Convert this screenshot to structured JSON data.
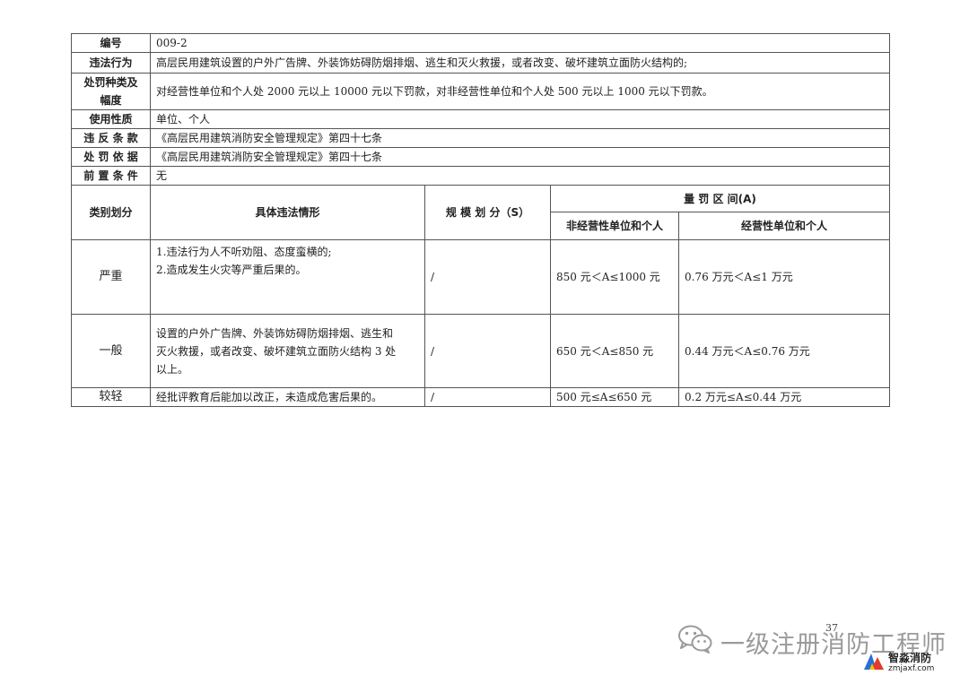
{
  "table": {
    "rows": {
      "code": {
        "label": "编号",
        "value": "009-2"
      },
      "violation": {
        "label": "违法行为",
        "value": "高层民用建筑设置的户外广告牌、外装饰妨碍防烟排烟、逃生和灭火救援，或者改变、破坏建筑立面防火结构的;"
      },
      "penalty": {
        "label_line1": "处罚种类及",
        "label_line2": "幅度",
        "value": "对经营性单位和个人处 2000 元以上 10000 元以下罚款，对非经营性单位和个人处 500 元以上 1000 元以下罚款。"
      },
      "nature": {
        "label": "使用性质",
        "value": "单位、个人"
      },
      "clause": {
        "label": "违 反 条 款",
        "value": "《高层民用建筑消防安全管理规定》第四十七条"
      },
      "basis": {
        "label": "处 罚 依 据",
        "value": "《高层民用建筑消防安全管理规定》第四十七条"
      },
      "precondition": {
        "label": "前 置 条 件",
        "value": "无"
      }
    },
    "headers": {
      "category": "类别划分",
      "situation": "具体违法情形",
      "scale": "规 模 划 分（S）",
      "range": "量 罚 区 间(A)",
      "non_business": "非经营性单位和个人",
      "business": "经营性单位和个人"
    },
    "levels": [
      {
        "category": "严重",
        "situation_lines": [
          "1.违法行为人不听劝阻、态度蛮横的;",
          "2.造成发生火灾等严重后果的。"
        ],
        "scale": "/",
        "non_business": "850 元＜A≤1000 元",
        "business": "0.76 万元＜A≤1 万元"
      },
      {
        "category": "一般",
        "situation_lines": [
          "设置的户外广告牌、外装饰妨碍防烟排烟、逃生和",
          "灭火救援，或者改变、破坏建筑立面防火结构 3 处",
          "以上。"
        ],
        "scale": "/",
        "non_business": "650 元＜A≤850 元",
        "business": "0.44 万元＜A≤0.76 万元"
      },
      {
        "category": "较轻",
        "situation_lines": [
          "经批评教育后能加以改正，未造成危害后果的。"
        ],
        "scale": "/",
        "non_business": "500 元≤A≤650 元",
        "business": "0.2 万元≤A≤0.44 万元"
      }
    ]
  },
  "page_number": "37",
  "watermark": {
    "text": "一级注册消防工程师",
    "icon": "wechat-icon"
  },
  "logo": {
    "name": "智淼消防",
    "url": "zmjaxf.com",
    "colors": {
      "red": "#e23b2e",
      "blue": "#2a6fd6",
      "yellow": "#f2c200"
    }
  }
}
